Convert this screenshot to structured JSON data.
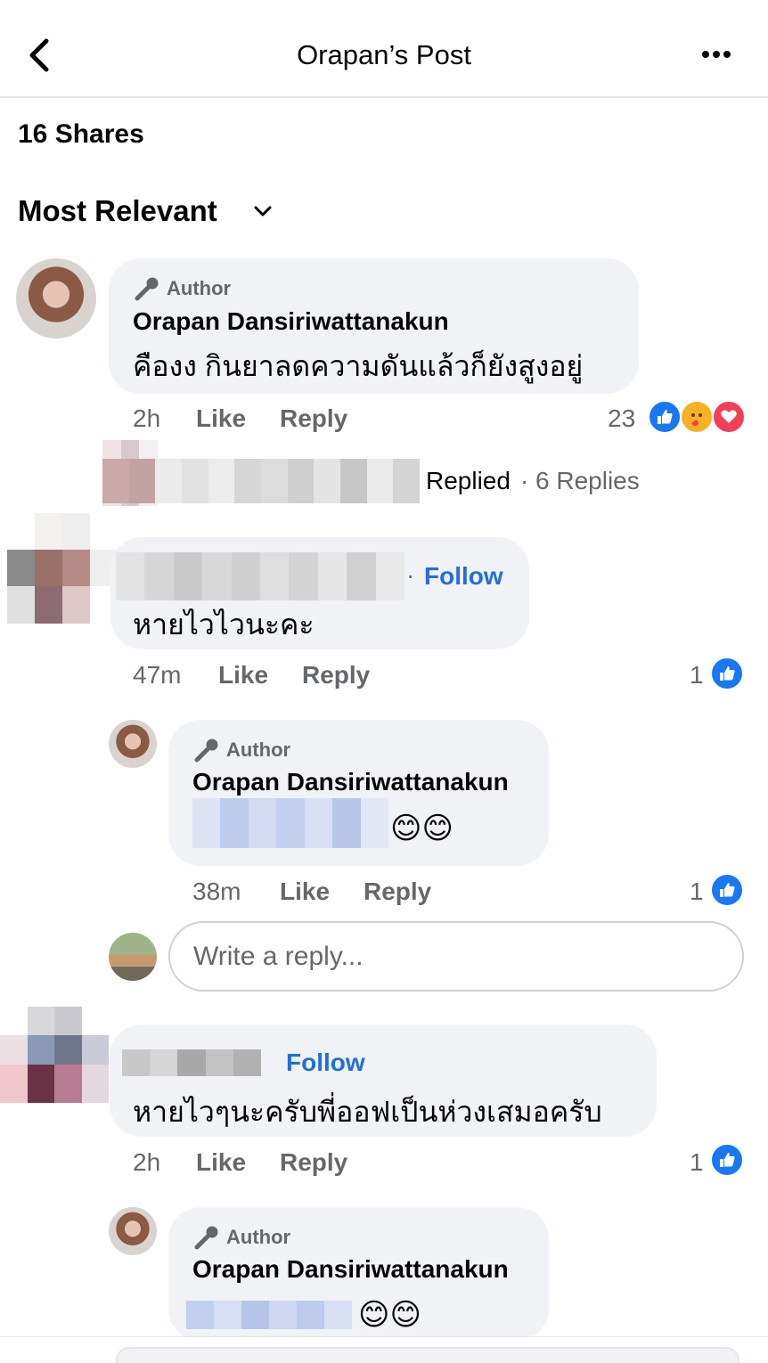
{
  "header": {
    "title": "Orapan’s Post"
  },
  "post": {
    "shares": "16 Shares"
  },
  "sort": {
    "label": "Most Relevant"
  },
  "comments": [
    {
      "author_tag": "Author",
      "name": "Orapan Dansiriwattanakun",
      "text": "คืองง กินยาลดความดันแล้วก็ยังสูงอยู่",
      "time": "2h",
      "like_label": "Like",
      "reply_label": "Reply",
      "reaction_count": "23",
      "replies_summary": {
        "replied": "Replied",
        "count": "6 Replies"
      }
    },
    {
      "follow": "Follow",
      "text": "หายไวไวนะคะ",
      "time": "47m",
      "like_label": "Like",
      "reply_label": "Reply",
      "reaction_count": "1",
      "reply": {
        "author_tag": "Author",
        "name": "Orapan Dansiriwattanakun",
        "emoji": "😊😊",
        "time": "38m",
        "like_label": "Like",
        "reply_label": "Reply",
        "reaction_count": "1"
      },
      "reply_input": {
        "placeholder": "Write a reply..."
      }
    },
    {
      "follow": "Follow",
      "text": "หายไวๆนะครับพี่ออฟเป็นห่วงเสมอครับ",
      "time": "2h",
      "like_label": "Like",
      "reply_label": "Reply",
      "reaction_count": "1",
      "reply": {
        "author_tag": "Author",
        "name": "Orapan Dansiriwattanakun",
        "emoji": "😊😊"
      }
    }
  ],
  "colors": {
    "accent": "#216fdb",
    "bubble": "#f0f2f5",
    "muted": "#65676b",
    "love": "#f33e58"
  }
}
